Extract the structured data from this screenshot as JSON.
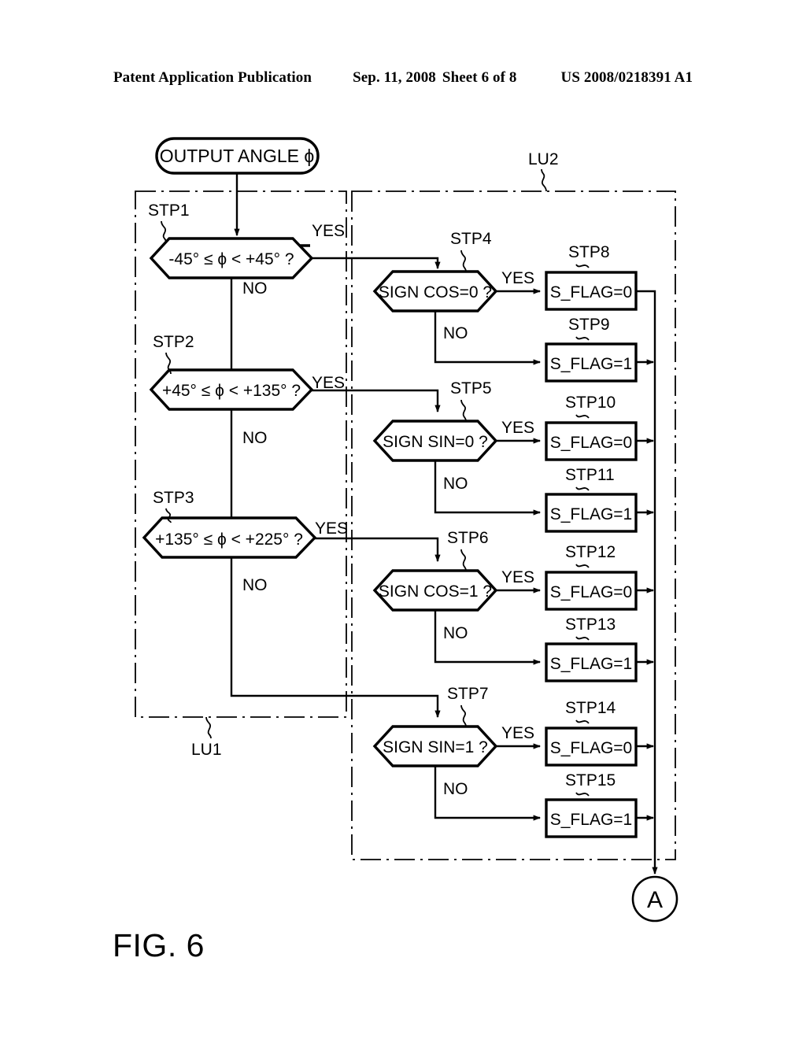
{
  "header": {
    "publication": "Patent Application Publication",
    "date": "Sep. 11, 2008",
    "sheet": "Sheet 6 of 8",
    "number": "US 2008/0218391 A1"
  },
  "figure": {
    "label": "FIG. 6"
  },
  "terminal": {
    "start": "OUTPUT ANGLE ϕ"
  },
  "regions": [
    {
      "id": "lu1",
      "label": "LU1"
    },
    {
      "id": "lu2",
      "label": "LU2"
    }
  ],
  "branch_labels": {
    "yes": "YES",
    "no": "NO"
  },
  "connector": {
    "label": "A"
  },
  "left_column": [
    {
      "step": "STP1",
      "text": "-45° ≤ ϕ < +45° ?",
      "yes": "YES",
      "no": "NO"
    },
    {
      "step": "STP2",
      "text": "+45° ≤ ϕ < +135° ?",
      "yes": "YES",
      "no": "NO"
    },
    {
      "step": "STP3",
      "text": "+135° ≤ ϕ < +225° ?",
      "yes": "YES",
      "no": "NO"
    }
  ],
  "right_column": [
    {
      "step": "STP4",
      "text": "SIGN COS=0 ?",
      "yes": "YES",
      "no": "NO",
      "yes_target": {
        "step": "STP8",
        "text": "S_FLAG=0"
      },
      "no_target": {
        "step": "STP9",
        "text": "S_FLAG=1"
      }
    },
    {
      "step": "STP5",
      "text": "SIGN SIN=0 ?",
      "yes": "YES",
      "no": "NO",
      "yes_target": {
        "step": "STP10",
        "text": "S_FLAG=0"
      },
      "no_target": {
        "step": "STP11",
        "text": "S_FLAG=1"
      }
    },
    {
      "step": "STP6",
      "text": "SIGN COS=1 ?",
      "yes": "YES",
      "no": "NO",
      "yes_target": {
        "step": "STP12",
        "text": "S_FLAG=0"
      },
      "no_target": {
        "step": "STP13",
        "text": "S_FLAG=1"
      }
    },
    {
      "step": "STP7",
      "text": "SIGN SIN=1 ?",
      "yes": "YES",
      "no": "NO",
      "yes_target": {
        "step": "STP14",
        "text": "S_FLAG=0"
      },
      "no_target": {
        "step": "STP15",
        "text": "S_FLAG=1"
      }
    }
  ],
  "colors": {
    "ink": "#000000",
    "paper": "#ffffff"
  }
}
